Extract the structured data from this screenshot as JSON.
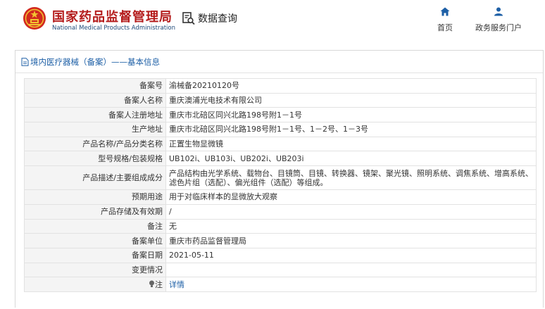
{
  "header": {
    "brand_cn": "国家药品监督管理局",
    "brand_en": "National Medical Products Administration",
    "data_query_label": "数据查询",
    "nav": [
      {
        "label": "首页",
        "icon": "home-icon"
      },
      {
        "label": "政务服务门户",
        "icon": "user-icon"
      }
    ]
  },
  "panel": {
    "title": "境内医疗器械（备案）——基本信息"
  },
  "rows": [
    {
      "label": "备案号",
      "value": "渝械备20210120号"
    },
    {
      "label": "备案人名称",
      "value": "重庆澳浦光电技术有限公司"
    },
    {
      "label": "备案人注册地址",
      "value": "重庆市北碚区同兴北路198号附1－1号"
    },
    {
      "label": "生产地址",
      "value": "重庆市北碚区同兴北路198号附1－1号、1－2号、1－3号"
    },
    {
      "label": "产品名称/产品分类名称",
      "value": "正置生物显微镜"
    },
    {
      "label": "型号规格/包装规格",
      "value": "UB102i、UB103i、UB202i、UB203i"
    },
    {
      "label": "产品描述/主要组成成分",
      "value": "产品结构由光学系统、载物台、目镜筒、目镜、转换器、镜架、聚光镜、照明系统、调焦系统、增高系统、滤色片组（选配）、偏光组件（选配）等组成。"
    },
    {
      "label": "预期用途",
      "value": "用于对临床样本的显微放大观察"
    },
    {
      "label": "产品存储及有效期",
      "value": "/"
    },
    {
      "label": "备注",
      "value": "无"
    },
    {
      "label": "备案单位",
      "value": "重庆市药品监督管理局"
    },
    {
      "label": "备案日期",
      "value": "2021-05-11"
    },
    {
      "label": "变更情况",
      "value": ""
    },
    {
      "label": "注",
      "value": "详情"
    }
  ],
  "colors": {
    "brand_red": "#b41c1c",
    "brand_blue": "#1f4a7a",
    "link_blue": "#1d5fa6",
    "label_bg": "#f4f4f4"
  }
}
